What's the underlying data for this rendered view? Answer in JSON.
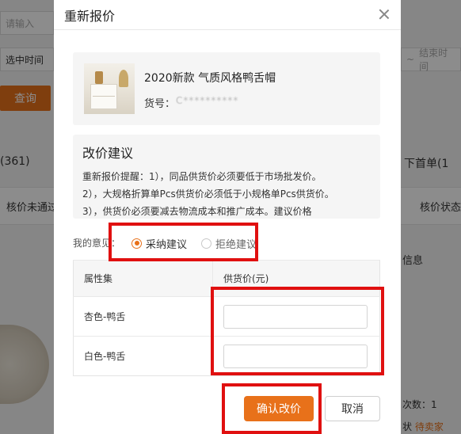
{
  "background": {
    "search_placeholder": "请输入",
    "start_time_placeholder": "选中时间",
    "end_time_placeholder": "结束时间",
    "dash": "~",
    "query_button": "查询",
    "tab_left": "(361)",
    "tab_right": "下首单(1",
    "col_left": "核价未通过",
    "col_right": "核价状态",
    "info_label": "信息",
    "count_label": "次数：1",
    "status_prefix": "状",
    "status_value": "待卖家"
  },
  "modal": {
    "title": "重新报价",
    "close_icon": "close-icon",
    "product": {
      "name": "2020新款 气质风格鸭舌帽",
      "sku_label": "货号：",
      "sku_value": "C**********"
    },
    "suggestion": {
      "title": "改价建议",
      "lines": [
        "重新报价提醒：1），同品供货价必须要低于市场批发价。",
        "2），大规格折算单Pcs供货价必须低于小规格单Pcs供货价。",
        "3），供货价必须要减去物流成本和推广成本。建议价格"
      ]
    },
    "opinion": {
      "label": "我的意见：",
      "options": [
        {
          "label": "采纳建议",
          "checked": true
        },
        {
          "label": "拒绝建议",
          "checked": false
        }
      ]
    },
    "table": {
      "headers": [
        "属性集",
        "供货价(元)"
      ],
      "rows": [
        {
          "attr": "杏色-鸭舌",
          "price": ""
        },
        {
          "attr": "白色-鸭舌",
          "price": ""
        }
      ]
    },
    "buttons": {
      "confirm": "确认改价",
      "cancel": "取消"
    }
  },
  "colors": {
    "accent": "#e8711a",
    "highlight": "#e01010"
  }
}
